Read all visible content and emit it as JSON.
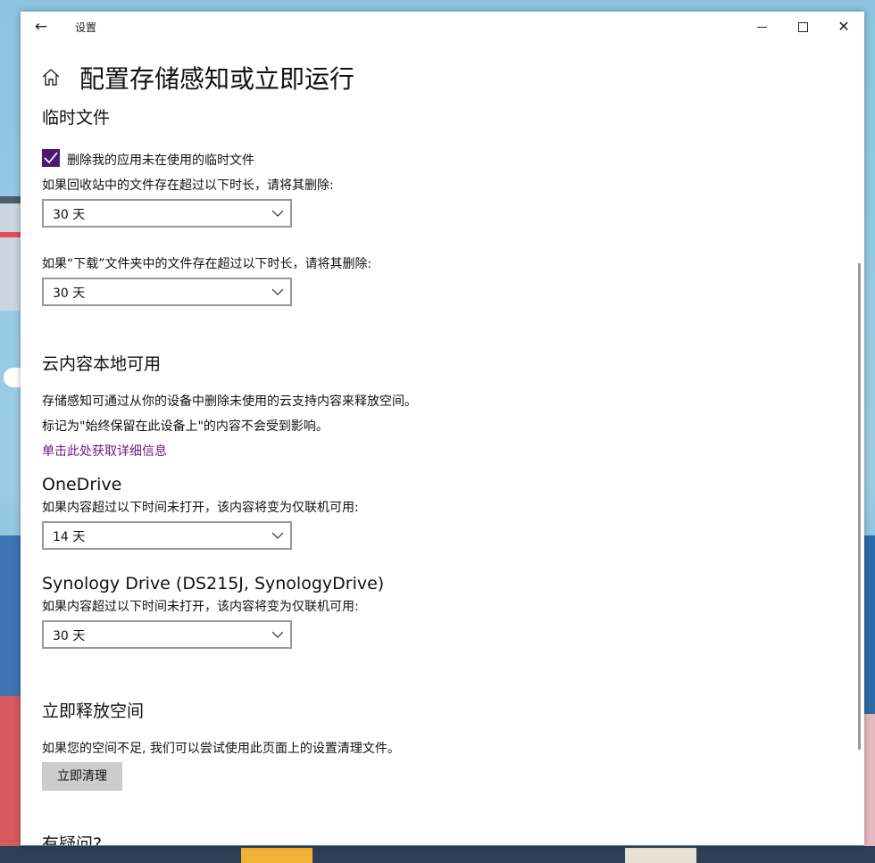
{
  "window": {
    "title": "设置",
    "back_glyph": "←",
    "close_glyph": "✕"
  },
  "page_title": "配置存储感知或立即运行",
  "temp_files": {
    "heading": "临时文件",
    "checkbox_label": "删除我的应用未在使用的临时文件",
    "checkbox_checked": true,
    "recycle_label": "如果回收站中的文件存在超过以下时长，请将其删除:",
    "recycle_value": "30 天",
    "downloads_label": "如果“下载”文件夹中的文件存在超过以下时长，请将其删除:",
    "downloads_value": "30 天"
  },
  "cloud": {
    "heading": "云内容本地可用",
    "desc1": "存储感知可通过从你的设备中删除未使用的云支持内容来释放空间。",
    "desc2": "标记为\"始终保留在此设备上\"的内容不会受到影响。",
    "link": "单击此处获取详细信息",
    "onedrive_title": "OneDrive",
    "onedrive_label": "如果内容超过以下时间未打开，该内容将变为仅联机可用:",
    "onedrive_value": "14 天",
    "synology_title": "Synology Drive (DS215J, SynologyDrive)",
    "synology_label": "如果内容超过以下时间未打开，该内容将变为仅联机可用:",
    "synology_value": "30 天"
  },
  "free_now": {
    "heading": "立即释放空间",
    "desc": "如果您的空间不足, 我们可以尝试使用此页面上的设置清理文件。",
    "button": "立即清理"
  },
  "questions_heading": "有疑问?",
  "icons": {
    "back": "back-arrow-icon",
    "home": "home-icon",
    "minimize": "minimize-icon",
    "maximize": "maximize-icon",
    "close": "close-icon",
    "dropdown": "chevron-down-icon",
    "check": "checkmark-icon"
  },
  "colors": {
    "accent": "#4b1b72",
    "link": "#6b1a8a",
    "button_bg": "#cccccc"
  }
}
